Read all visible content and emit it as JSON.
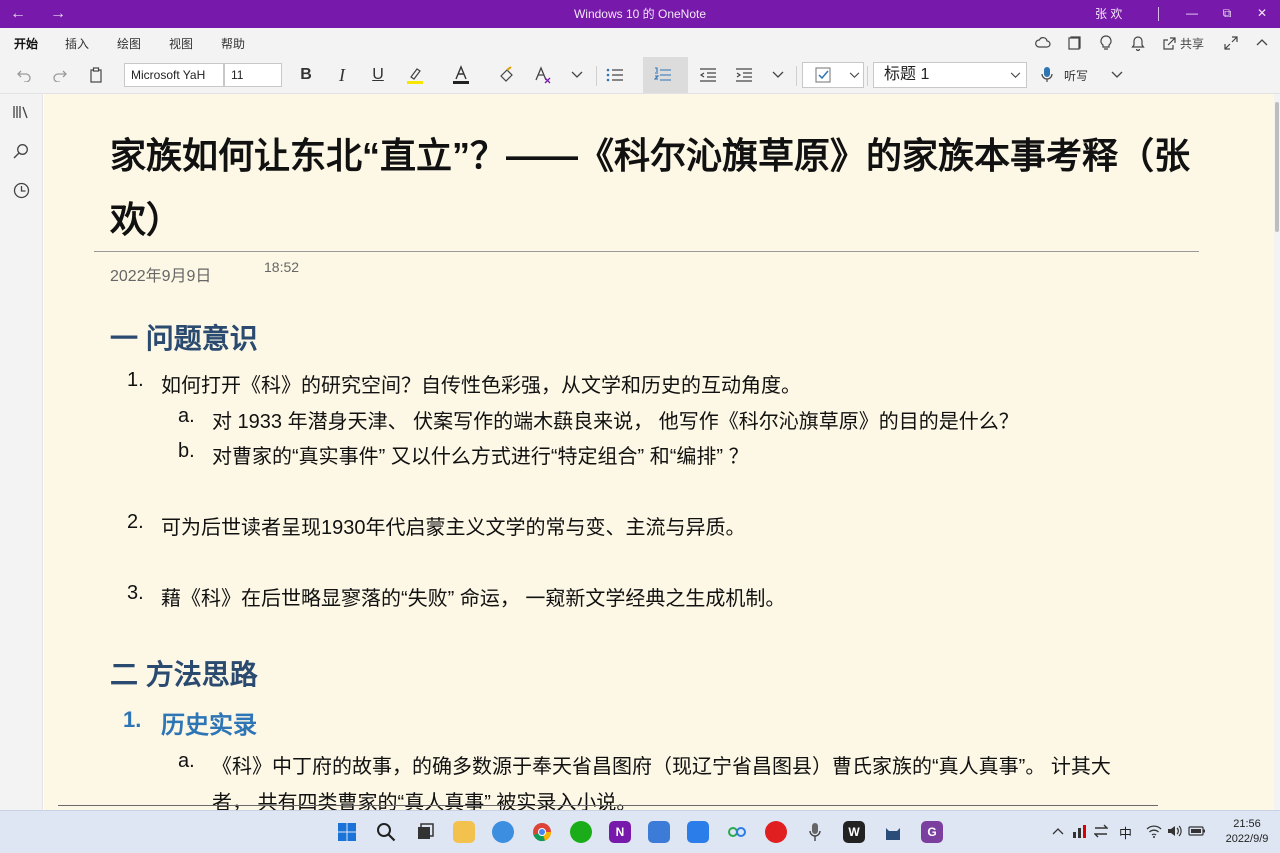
{
  "window": {
    "title": "Windows 10 的 OneNote",
    "user": "张 欢",
    "back_icon": "←",
    "forward_icon": "→",
    "minimize": "—",
    "restore": "⧉",
    "close": "✕"
  },
  "ribbon": {
    "tabs": [
      "开始",
      "插入",
      "绘图",
      "视图",
      "帮助"
    ],
    "share_label": "共享"
  },
  "toolbar": {
    "font_name": "Microsoft YaH",
    "font_size": "11",
    "bold": "B",
    "italic": "I",
    "underline": "U",
    "style": "标题 1",
    "dictate": "听写"
  },
  "page": {
    "title": "家族如何让东北“直立”？——《科尔沁旗草原》的家族本事考释（张欢）",
    "date": "2022年9月9日",
    "time": "18:52",
    "section1": {
      "heading": "一 问题意识",
      "items": [
        {
          "num": "1.",
          "text": "如何打开《科》的研究空间？自传性色彩强，从文学和历史的互动角度。"
        },
        {
          "num": "a.",
          "text": "对 1933 年潜身天津、 伏案写作的端木蕻良来说， 他写作《科尔沁旗草原》的目的是什么？"
        },
        {
          "num": "b.",
          "text": "对曹家的“真实事件” 又以什么方式进行“特定组合” 和“编排” ？"
        },
        {
          "num": "2.",
          "text": "可为后世读者呈现1930年代启蒙主义文学的常与变、主流与异质。"
        },
        {
          "num": "3.",
          "text": "藉《科》在后世略显寥落的“失败” 命运， 一窥新文学经典之生成机制。"
        }
      ]
    },
    "section2": {
      "heading": "二 方法思路",
      "sub_num": "1.",
      "sub_heading": "历史实录",
      "item_num": "a.",
      "item_line1": "《科》中丁府的故事，的确多数源于奉天省昌图府（现辽宁省昌图县）曹氏家族的“真人真事”。 计其大",
      "item_line2": "者， 共有四类曹家的“真人真事” 被实录入小说。"
    }
  },
  "taskbar": {
    "ime": "中",
    "clock_time": "21:56",
    "clock_date": "2022/9/9"
  },
  "colors": {
    "titlebar": "#7719aa",
    "canvas": "#fdf8e6",
    "heading1": "#2b4a70",
    "heading2": "#2e75b6"
  }
}
